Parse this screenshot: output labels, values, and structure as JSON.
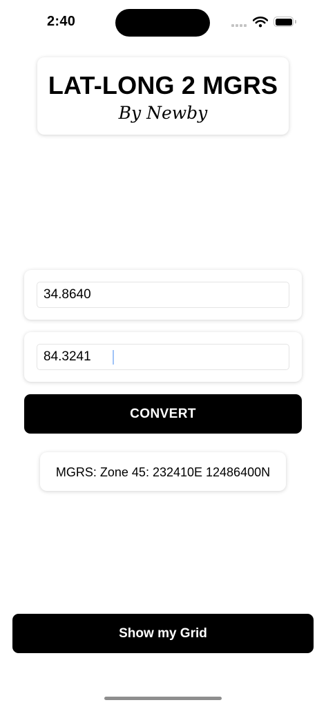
{
  "status_bar": {
    "time": "2:40",
    "icons": [
      "cellular-signal-icon",
      "wifi-icon",
      "battery-icon"
    ]
  },
  "header": {
    "title": "LAT-LONG 2 MGRS",
    "subtitle": "By Newby"
  },
  "form": {
    "latitude_value": "34.8640",
    "longitude_value": "84.3241",
    "convert_label": "CONVERT"
  },
  "result": {
    "text": "MGRS: Zone 45: 232410E 12486400N"
  },
  "footer": {
    "grid_button_label": "Show my Grid"
  },
  "colors": {
    "accent": "#000000",
    "background": "#ffffff",
    "caret": "#9fc3f7"
  }
}
